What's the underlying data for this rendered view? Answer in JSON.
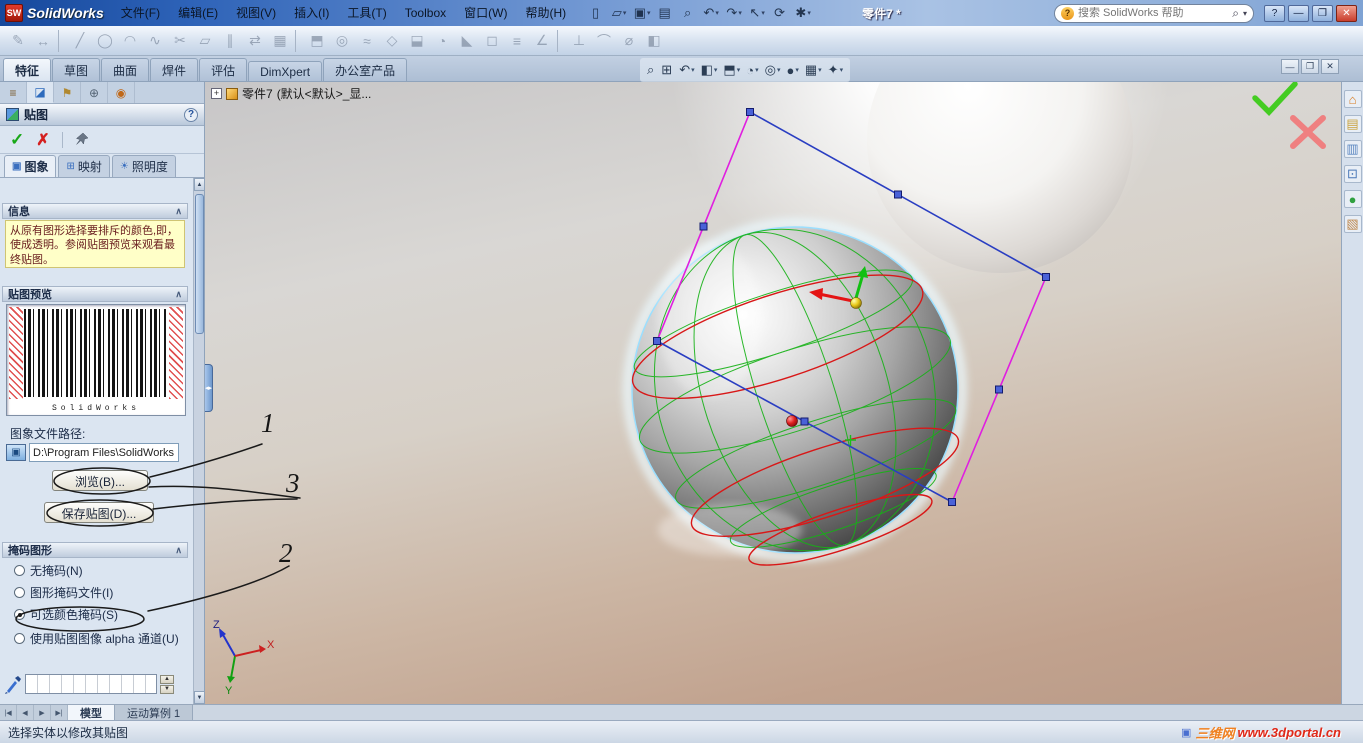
{
  "window": {
    "logo_badge": "SW",
    "app_name": "SolidWorks",
    "doc_title": "零件7 *",
    "search": {
      "placeholder": "搜索 SolidWorks 帮助"
    },
    "controls": {
      "help": "?",
      "minimize": "—",
      "maximize": "❐",
      "close": "✕"
    }
  },
  "menubar": [
    "文件(F)",
    "编辑(E)",
    "视图(V)",
    "插入(I)",
    "工具(T)",
    "Toolbox",
    "窗口(W)",
    "帮助(H)"
  ],
  "toolbar_quick": [
    {
      "name": "new-document-icon",
      "glyph": "▯",
      "caret": ""
    },
    {
      "name": "open-icon",
      "glyph": "▱",
      "caret": "▾"
    },
    {
      "name": "save-icon",
      "glyph": "▣",
      "caret": "▾"
    },
    {
      "name": "print-icon",
      "glyph": "▤",
      "caret": ""
    },
    {
      "name": "print-preview-icon",
      "glyph": "⌕",
      "caret": ""
    },
    {
      "name": "undo-icon",
      "glyph": "↶",
      "caret": "▾"
    },
    {
      "name": "redo-icon",
      "glyph": "↷",
      "caret": "▾"
    },
    {
      "name": "select-icon",
      "glyph": "↖",
      "caret": "▾"
    },
    {
      "name": "rebuild-icon",
      "glyph": "⟳",
      "caret": ""
    },
    {
      "name": "options-icon",
      "glyph": "✱",
      "caret": "▾"
    }
  ],
  "toolbar_main": [
    {
      "name": "sketch-icon",
      "glyph": "✎"
    },
    {
      "name": "smart-dimension-icon",
      "glyph": "↔"
    },
    {
      "name": "separator",
      "glyph": "",
      "sep": true
    },
    {
      "name": "line-icon",
      "glyph": "╱"
    },
    {
      "name": "circle-icon",
      "glyph": "◯"
    },
    {
      "name": "arc-icon",
      "glyph": "◠"
    },
    {
      "name": "spline-icon",
      "glyph": "∿"
    },
    {
      "name": "trim-entities-icon",
      "glyph": "✂"
    },
    {
      "name": "convert-entities-icon",
      "glyph": "▱"
    },
    {
      "name": "offset-entities-icon",
      "glyph": "∥"
    },
    {
      "name": "mirror-entities-icon",
      "glyph": "⇄"
    },
    {
      "name": "linear-pattern-icon",
      "glyph": "▦"
    },
    {
      "name": "separator",
      "glyph": "",
      "sep": true
    },
    {
      "name": "extruded-boss-icon",
      "glyph": "⬒"
    },
    {
      "name": "revolved-boss-icon",
      "glyph": "◎"
    },
    {
      "name": "swept-boss-icon",
      "glyph": "≈"
    },
    {
      "name": "lofted-boss-icon",
      "glyph": "◇"
    },
    {
      "name": "extruded-cut-icon",
      "glyph": "⬓"
    },
    {
      "name": "fillet-icon",
      "glyph": "◔"
    },
    {
      "name": "chamfer-icon",
      "glyph": "◣"
    },
    {
      "name": "shell-icon",
      "glyph": "◻"
    },
    {
      "name": "rib-icon",
      "glyph": "≡"
    },
    {
      "name": "draft-icon",
      "glyph": "∠"
    },
    {
      "name": "separator",
      "glyph": "",
      "sep": true
    },
    {
      "name": "reference-geometry-icon",
      "glyph": "⊥"
    },
    {
      "name": "curves-icon",
      "glyph": "⌒"
    },
    {
      "name": "measure-icon",
      "glyph": "⌀"
    },
    {
      "name": "section-icon",
      "glyph": "◧"
    }
  ],
  "command_tabs": [
    {
      "label": "特征",
      "active": true
    },
    {
      "label": "草图",
      "active": false
    },
    {
      "label": "曲面",
      "active": false
    },
    {
      "label": "焊件",
      "active": false
    },
    {
      "label": "评估",
      "active": false
    },
    {
      "label": "DimXpert",
      "active": false
    },
    {
      "label": "办公室产品",
      "active": false
    }
  ],
  "headsup": [
    {
      "name": "zoom-to-fit-icon",
      "glyph": "⌕",
      "caret": ""
    },
    {
      "name": "zoom-to-area-icon",
      "glyph": "⊞",
      "caret": ""
    },
    {
      "name": "previous-view-icon",
      "glyph": "↶",
      "caret": "▾"
    },
    {
      "name": "section-view-icon",
      "glyph": "◧",
      "caret": "▾"
    },
    {
      "name": "view-orientation-icon",
      "glyph": "⬒",
      "caret": "▾"
    },
    {
      "name": "display-style-icon",
      "glyph": "◔",
      "caret": "▾"
    },
    {
      "name": "hide-show-items-icon",
      "glyph": "◎",
      "caret": "▾"
    },
    {
      "name": "edit-appearance-icon",
      "glyph": "●",
      "caret": "▾"
    },
    {
      "name": "apply-scene-icon",
      "glyph": "▦",
      "caret": "▾"
    },
    {
      "name": "view-settings-icon",
      "glyph": "✦",
      "caret": "▾"
    }
  ],
  "child_controls": [
    {
      "name": "doc-minimize-button",
      "glyph": "—"
    },
    {
      "name": "doc-restore-button",
      "glyph": "❐"
    },
    {
      "name": "doc-close-button",
      "glyph": "✕"
    }
  ],
  "pm_tabs": [
    {
      "name": "featuremanager-tab",
      "glyph": "≡",
      "color": "#7a5c2e",
      "active": false
    },
    {
      "name": "propertymanager-tab",
      "glyph": "◪",
      "color": "#2e6bbd",
      "active": true
    },
    {
      "name": "configurationmanager-tab",
      "glyph": "⚑",
      "color": "#b08830",
      "active": false
    },
    {
      "name": "dimxpertmanager-tab",
      "glyph": "⊕",
      "color": "#566676",
      "active": false
    },
    {
      "name": "displaymanager-tab",
      "glyph": "◉",
      "color": "#c06818",
      "active": false
    }
  ],
  "property_panel": {
    "header": {
      "title": "贴图",
      "help": "?"
    },
    "actions": {
      "ok": "✓",
      "cancel": "✗"
    },
    "tabs": [
      {
        "label": "图象",
        "icon": "▣",
        "active": true
      },
      {
        "label": "映射",
        "icon": "⊞",
        "active": false
      },
      {
        "label": "照明度",
        "icon": "☀",
        "active": false
      }
    ],
    "info": {
      "header": "信息",
      "text": "从原有图形选择要排斥的颜色,即，使成透明。参阅贴图预览来观看最终贴图。"
    },
    "preview": {
      "header": "贴图预览",
      "caption": "SolidWorks"
    },
    "file": {
      "label": "图象文件路径:",
      "path": "D:\\Program Files\\SolidWorks",
      "browse": "浏览(B)...",
      "save": "保存贴图(D)..."
    },
    "mask": {
      "header": "掩码图形",
      "options": [
        {
          "label": "无掩码(N)",
          "selected": false
        },
        {
          "label": "图形掩码文件(I)",
          "selected": false
        },
        {
          "label": "可选颜色掩码(S)",
          "selected": true
        },
        {
          "label": "使用贴图图像 alpha 通道(U)",
          "selected": false
        }
      ]
    }
  },
  "feature_tree": {
    "expander": "+",
    "part": "零件7",
    "config": "(默认<默认>_显..."
  },
  "viewport": {
    "triad": {
      "x": "X",
      "y": "Y",
      "z": "Z"
    }
  },
  "taskpane": [
    {
      "name": "solidworks-resources-icon",
      "glyph": "⌂",
      "color": "#d87c20"
    },
    {
      "name": "design-library-icon",
      "glyph": "▤",
      "color": "#caa23c"
    },
    {
      "name": "file-explorer-icon",
      "glyph": "▥",
      "color": "#5a86c0"
    },
    {
      "name": "view-palette-icon",
      "glyph": "⊡",
      "color": "#4a78b8"
    },
    {
      "name": "appearances-icon",
      "glyph": "●",
      "color": "#30a040"
    },
    {
      "name": "custom-properties-icon",
      "glyph": "▧",
      "color": "#c08a50"
    }
  ],
  "bottom_tabs": {
    "nav": [
      "|◀",
      "◀",
      "▶",
      "▶|"
    ],
    "tabs": [
      {
        "label": "模型",
        "active": true
      },
      {
        "label": "运动算例 1",
        "active": false
      }
    ]
  },
  "status": {
    "text": "选择实体以修改其贴图",
    "watermark_site": "三维网",
    "watermark_url": "www.3dportal.cn"
  },
  "annotations": {
    "n1": "1",
    "n2": "2",
    "n3": "3"
  },
  "colors": {
    "titlebar_blue": "#2e63b8",
    "panel_bg": "#dbe5f1",
    "info_yellow": "#ffffc8",
    "wireframe_green": "#16b216",
    "mapping_red": "#d81818",
    "decal_magenta": "#e01ee0",
    "decal_blue": "#2a3ec2",
    "confirm_green": "#44cc22",
    "confirm_red": "#ef8080",
    "watermark_red": "#e02818"
  }
}
